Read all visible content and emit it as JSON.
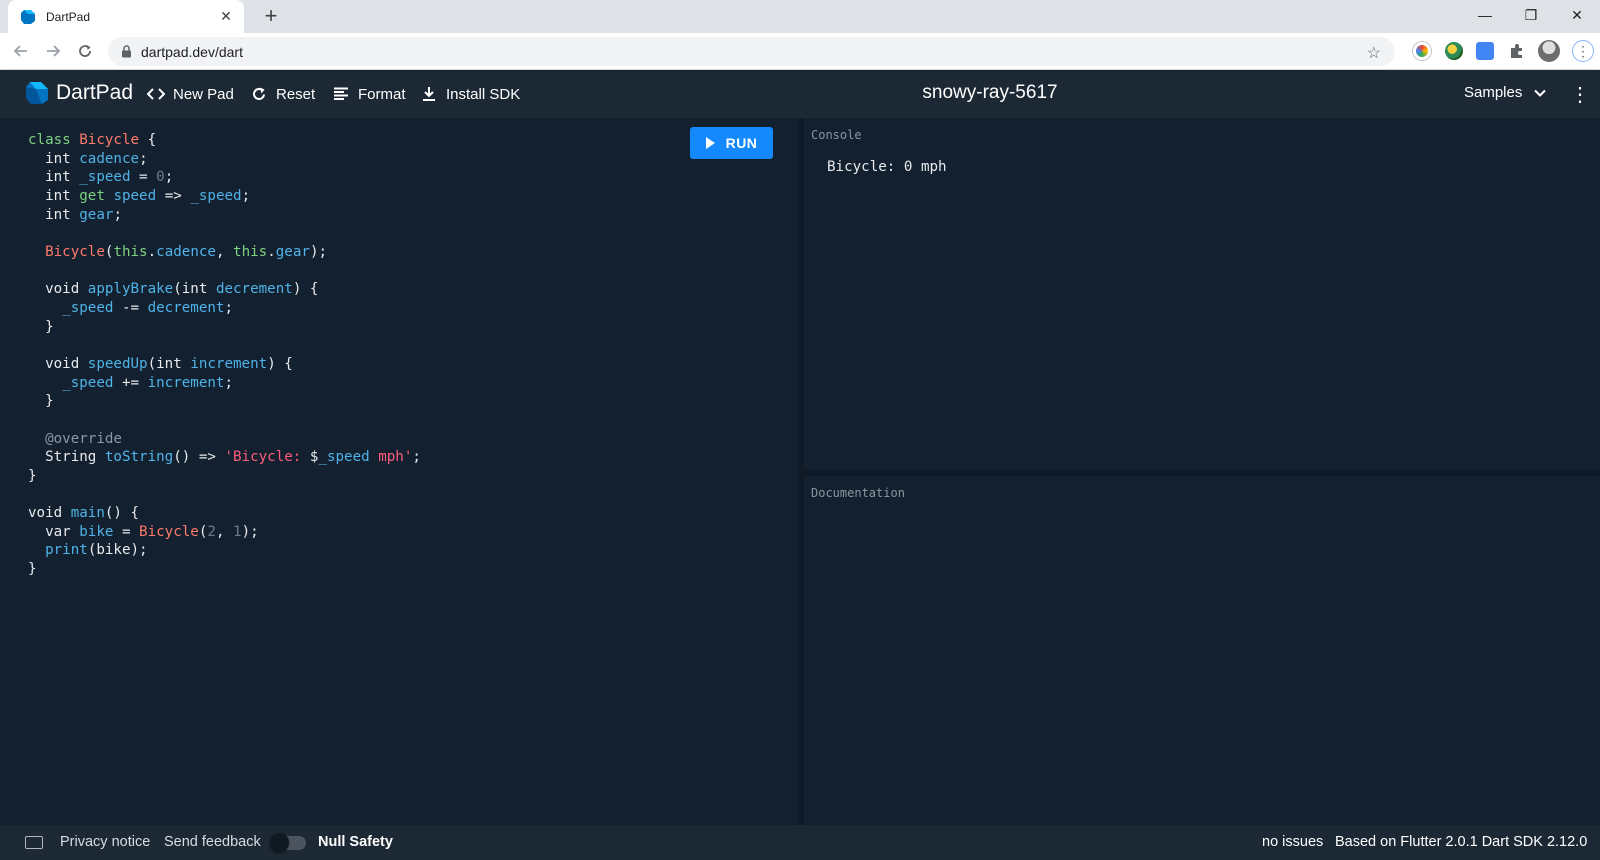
{
  "browser": {
    "tab_title": "DartPad",
    "tab_close": "✕",
    "new_tab": "+",
    "url": "dartpad.dev/dart",
    "win_minimize": "—",
    "win_restore": "❐",
    "win_close": "✕"
  },
  "header": {
    "app_title": "DartPad",
    "new_pad": "New Pad",
    "reset": "Reset",
    "format": "Format",
    "install_sdk": "Install SDK",
    "pad_name": "snowy-ray-5617",
    "samples": "Samples"
  },
  "editor": {
    "run_label": "RUN",
    "language": "dart"
  },
  "console": {
    "label": "Console",
    "output": "Bicycle: 0 mph"
  },
  "documentation": {
    "label": "Documentation"
  },
  "footer": {
    "privacy": "Privacy notice",
    "feedback": "Send feedback",
    "null_safety": "Null Safety",
    "null_safety_enabled": false,
    "issues": "no issues",
    "version": "Based on Flutter 2.0.1 Dart SDK 2.12.0"
  },
  "colors": {
    "accent": "#1389fd",
    "background": "#13202f",
    "header": "#1c2834"
  }
}
